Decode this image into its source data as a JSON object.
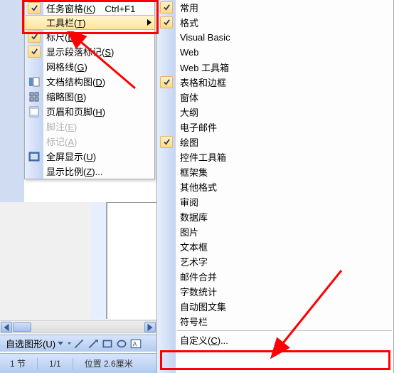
{
  "left_menu": {
    "task_pane": "任务窗格(K)　Ctrl+F1",
    "toolbar": "工具栏(T)",
    "ruler": "标尺(L)",
    "para_marks": "显示段落标记(S)",
    "gridlines": "网格线(G)",
    "doc_map": "文档结构图(D)",
    "thumbnails": "缩略图(B)",
    "header_footer": "页眉和页脚(H)",
    "footnotes": "脚注(E)",
    "markup": "标记(A)",
    "full_screen": "全屏显示(U)",
    "zoom": "显示比例(Z)..."
  },
  "submenu": {
    "items": [
      {
        "label": "常用",
        "checked": true
      },
      {
        "label": "格式",
        "checked": true
      },
      {
        "label": "Visual Basic",
        "checked": false
      },
      {
        "label": "Web",
        "checked": false
      },
      {
        "label": "Web 工具箱",
        "checked": false
      },
      {
        "label": "表格和边框",
        "checked": true
      },
      {
        "label": "窗体",
        "checked": false
      },
      {
        "label": "大纲",
        "checked": false
      },
      {
        "label": "电子邮件",
        "checked": false
      },
      {
        "label": "绘图",
        "checked": true
      },
      {
        "label": "控件工具箱",
        "checked": false
      },
      {
        "label": "框架集",
        "checked": false
      },
      {
        "label": "其他格式",
        "checked": false
      },
      {
        "label": "审阅",
        "checked": false
      },
      {
        "label": "数据库",
        "checked": false
      },
      {
        "label": "图片",
        "checked": false
      },
      {
        "label": "文本框",
        "checked": false
      },
      {
        "label": "艺术字",
        "checked": false
      },
      {
        "label": "邮件合并",
        "checked": false
      },
      {
        "label": "字数统计",
        "checked": false
      },
      {
        "label": "自动图文集",
        "checked": false
      },
      {
        "label": "符号栏",
        "checked": false
      }
    ],
    "customize": "自定义(C)..."
  },
  "toolbar": {
    "autoshapes": "自选图形(U)"
  },
  "status": {
    "section": "1 节",
    "page": "1/1",
    "position": "位置 2.6厘米"
  }
}
